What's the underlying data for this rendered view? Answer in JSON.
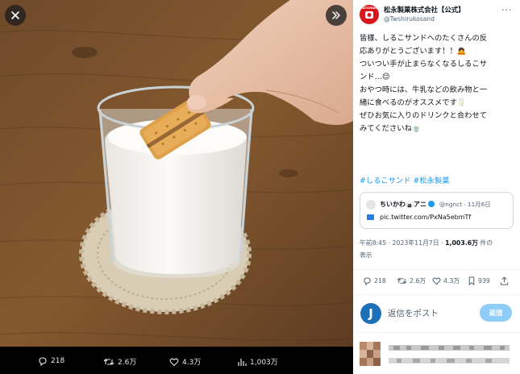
{
  "media_bar": {
    "replies": "218",
    "retweets": "2.6万",
    "likes": "4.3万",
    "views": "1,003万"
  },
  "account": {
    "avatar_text": "MATSUNAGA",
    "display_name": "松永製菓株式会社【公式】",
    "handle": "@Twshirukosand"
  },
  "tweet": {
    "lines": [
      "皆様、しるこサンドへのたくさんの反",
      "応ありがとうございます！！🙇",
      "",
      "ついつい手が止まらなくなるしるこサ",
      "ンド…😌",
      "おやつ時には、牛乳などの飲み物と一",
      "緒に食べるのがオススメです🥛",
      "",
      "ぜひお気に入りのドリンクと合わせて",
      "みてくださいね🍵"
    ],
    "hashtags": "#しるこサンド #松永製菓"
  },
  "quote": {
    "name": "ちいかわ🍙アニ",
    "meta": "@ngnct · 11月6日",
    "link": "pic.twitter.com/PxNa5ebmTf"
  },
  "timeline": {
    "time": "午前8:45 · 2023年11月7日 · ",
    "views": "1,003.6万",
    "views_suffix": " 件の",
    "line2": "表示"
  },
  "stats": {
    "replies": "218",
    "retweets": "2.6万",
    "likes": "4.3万",
    "bookmarks": "939"
  },
  "reply": {
    "avatar_letter": "J",
    "placeholder": "返信をポスト",
    "button": "返信"
  },
  "colors": {
    "accent": "#1d9bf0",
    "brand_red": "#d8171c",
    "reply_button": "#8ecdf8",
    "muted": "#536471"
  },
  "icons": [
    "close-icon",
    "expand-icon",
    "reply-icon",
    "retweet-icon",
    "like-icon",
    "views-icon",
    "bookmark-icon",
    "share-icon",
    "more-icon",
    "verified-icon",
    "link-image-icon"
  ]
}
